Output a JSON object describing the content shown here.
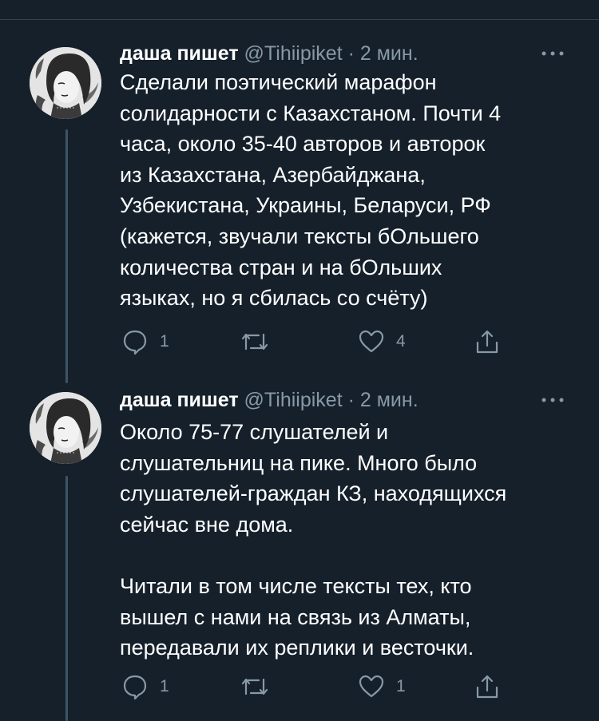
{
  "tweets": [
    {
      "author_name": "даша пишет",
      "handle": "@Tihiipiket",
      "separator": "·",
      "time": "2 мин.",
      "text": "Сделали поэтический марафон\nсолидарности с Казахстаном. Почти 4\nчаса, около 35-40 авторов и авторок\nиз Казахстана, Азербайджана,\nУзбекистана, Украины, Беларуси, РФ\n(кажется, звучали тексты бОльшего\nколичества стран и на бОльших\nязыках, но я сбилась со счёту)",
      "reply_count": "1",
      "retweet_count": "",
      "like_count": "4"
    },
    {
      "author_name": "даша пишет",
      "handle": "@Tihiipiket",
      "separator": "·",
      "time": "2 мин.",
      "text": "Около 75-77 слушателей и\nслушательниц на пике. Много было\nслушателей-граждан КЗ, находящихся\nсейчас вне дома.\n\nЧитали в том числе тексты тех, кто\nвышел с нами на связь из Алматы,\nпередавали их реплики и весточки.",
      "reply_count": "1",
      "retweet_count": "",
      "like_count": "1"
    }
  ],
  "colors": {
    "background": "#15202b",
    "text": "#ffffff",
    "secondary": "#8899a6",
    "thread_line": "#3d5466",
    "divider": "#38444d"
  },
  "icons": [
    "more-icon",
    "reply-icon",
    "retweet-icon",
    "like-icon",
    "share-icon"
  ]
}
